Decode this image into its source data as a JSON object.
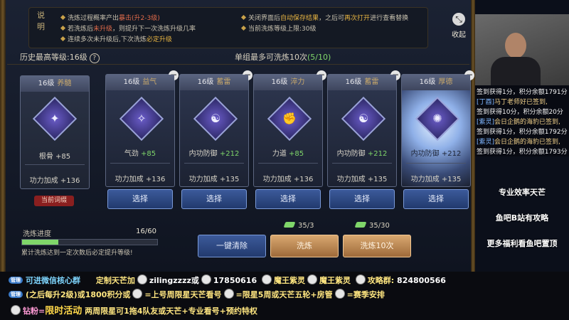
{
  "info": {
    "title": "说明",
    "lines_left": [
      {
        "text": "洗炼过程概率产出",
        "em": "暴击(升2-3级)",
        "em_class": "em2",
        "after": ""
      },
      {
        "text": "若洗炼后",
        "em": "未升级",
        "em_class": "em2",
        "after": "，则提升下一次洗炼升级几率"
      },
      {
        "text": "连续多次未升级后,下次洗炼",
        "em": "必定升级",
        "em_class": "em",
        "after": ""
      }
    ],
    "lines_right": [
      {
        "text": "关闭界面后",
        "em": "自动保存结果",
        "em_class": "em",
        "after": "，之后可",
        "em2": "再次打开",
        "after2": "进行查看替换"
      },
      {
        "text": "当前洗炼等级上限:30级",
        "em": "",
        "em_class": "em",
        "after": "",
        "em2": "",
        "after2": ""
      }
    ],
    "collapse_label": "收起"
  },
  "history": {
    "label": "历史最高等级:",
    "value": "16级",
    "help": "?"
  },
  "group_max": {
    "label": "单组最多可洗炼10次",
    "count": "(5/10)"
  },
  "current": {
    "level": "16级",
    "name": "养髓",
    "stat_name": "根骨",
    "stat_value": "+85",
    "bonus_label": "功力加成",
    "bonus_value": "+136",
    "badge": "当前词缀",
    "icon": "mystic-rune-icon"
  },
  "options": [
    {
      "level": "16级",
      "name": "益气",
      "stat_name": "气劲",
      "stat_value": "+85",
      "bonus_label": "功力加成",
      "bonus_value": "+136",
      "select": "选择",
      "icon": "feather-rune-icon"
    },
    {
      "level": "16级",
      "name": "蓄雷",
      "stat_name": "内功防御",
      "stat_value": "+212",
      "bonus_label": "功力加成",
      "bonus_value": "+135",
      "select": "选择",
      "icon": "thunder-rune-icon"
    },
    {
      "level": "16级",
      "name": "淬力",
      "stat_name": "力道",
      "stat_value": "+85",
      "bonus_label": "功力加成",
      "bonus_value": "+136",
      "select": "选择",
      "icon": "fist-rune-icon"
    },
    {
      "level": "16级",
      "name": "蓄雷",
      "stat_name": "内功防御",
      "stat_value": "+212",
      "bonus_label": "功力加成",
      "bonus_value": "+135",
      "select": "选择",
      "icon": "thunder-rune-icon"
    },
    {
      "level": "16级",
      "name": "厚德",
      "stat_name": "内功防御",
      "stat_value": "+212",
      "bonus_label": "功力加成",
      "bonus_value": "+135",
      "select": "选择",
      "icon": "glow-rune-icon"
    }
  ],
  "progress": {
    "label": "洗炼进度",
    "current": 16,
    "max": 60,
    "text": "16/60",
    "note": "累计洗炼达到一定次数后必定提升等级!"
  },
  "actions": {
    "clear": "一键清除",
    "wash": "洗炼",
    "wash10": "洗炼10次",
    "cost_wash": "35/3",
    "cost_wash10": "35/30"
  },
  "chat": [
    {
      "tag": "",
      "text": "签到获得1分，积分余额1791分"
    },
    {
      "tag": "[丁酉]",
      "text": "马丁老师好已签到,"
    },
    {
      "tag": "",
      "text": "签到获得10分，积分余额20分"
    },
    {
      "tag": "[紫灵]",
      "text": "会日企鹅的海豹已签到,"
    },
    {
      "tag": "",
      "text": "签到获得1分，积分余额1792分"
    },
    {
      "tag": "[紫灵]",
      "text": "会日企鹅的海豹已签到,"
    },
    {
      "tag": "",
      "text": "签到获得1分，积分余额1793分"
    }
  ],
  "side_ads": [
    "专业效率天芒",
    "鱼吧B站有攻略",
    "更多福利看鱼吧置顶"
  ],
  "strip": {
    "line1": {
      "pill": "管理",
      "a": "可进微信核心群",
      "b": "定制天芒加",
      "c": "zilingzzzz或",
      "d": "17850616",
      "e": "魔王紫灵",
      "f": "魔王紫灵",
      "g": "攻略群:",
      "h": "824800566"
    },
    "line2": {
      "pill": "管理",
      "a": "(之后每升2级)或1800积分或",
      "b": "=上号周限星天芒看号",
      "c": "=限星5周或天芒五轮+房管",
      "d": "=赛季安排"
    },
    "line3": {
      "a": "钻粉=",
      "b": "限时活动",
      "c": "两周限星可1拖4队友或天芒+专业看号+预约特权"
    }
  },
  "colors": {
    "accent_green": "#7fd66a",
    "gold": "#e8b542",
    "red": "#e06a4a",
    "button_blue": "#3c5a9a",
    "button_orange": "#d9a870"
  }
}
